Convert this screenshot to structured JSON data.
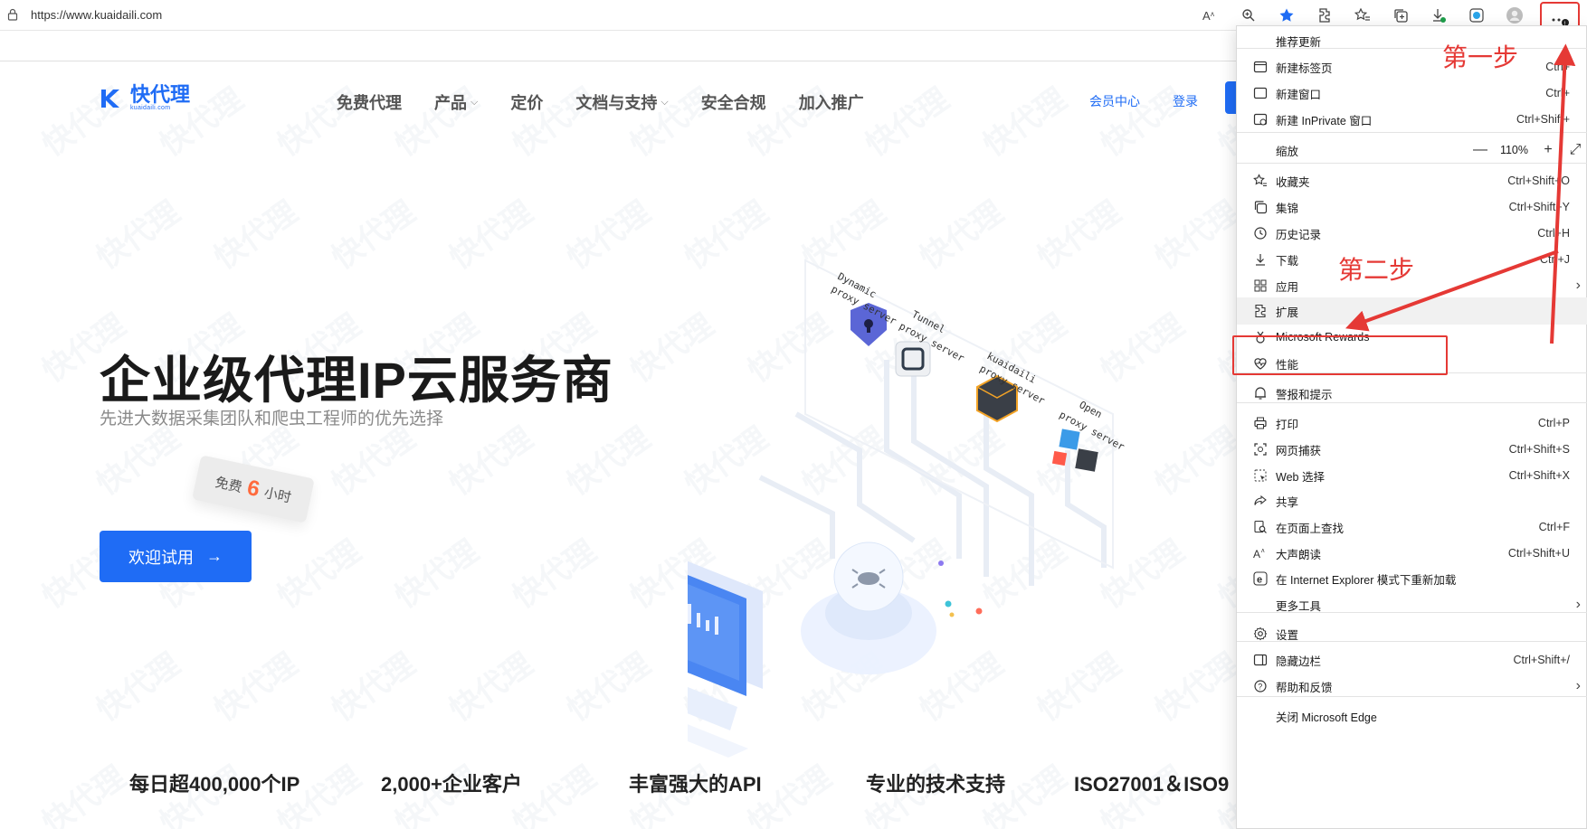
{
  "browser": {
    "url": "https://www.kuaidaili.com",
    "toolbar_icons": [
      "read-aloud-icon",
      "zoom-icon",
      "favorite-star-icon",
      "extensions-icon",
      "favorites-icon",
      "collections-icon",
      "downloads-icon",
      "edge-icon",
      "profile-icon",
      "more-icon"
    ]
  },
  "site": {
    "logo_text": "快代理",
    "logo_sub": "kuaidaili.com",
    "nav": [
      {
        "label": "免费代理",
        "has_caret": false
      },
      {
        "label": "产品",
        "has_caret": true
      },
      {
        "label": "定价",
        "has_caret": false
      },
      {
        "label": "文档与支持",
        "has_caret": true
      },
      {
        "label": "安全合规",
        "has_caret": false
      },
      {
        "label": "加入推广",
        "has_caret": false
      }
    ],
    "member_center": "会员中心",
    "login": "登录",
    "watermark_text": "快代理",
    "hero_title": "企业级代理IP云服务商",
    "hero_subtitle": "先进大数据采集团队和爬虫工程师的优先选择",
    "free_tag": {
      "prefix": "免费",
      "num": "6",
      "suffix": "小时"
    },
    "cta_label": "欢迎试用",
    "cta_arrow": "→",
    "illustration_labels": {
      "dynamic": [
        "Dynamic",
        "proxy server"
      ],
      "tunnel": [
        "Tunnel",
        "proxy server"
      ],
      "kuaidaili": [
        "kuaidaili",
        "proxy server"
      ],
      "open": [
        "Open",
        "proxy server"
      ]
    },
    "stats": [
      "每日超400,000个IP",
      "2,000+企业客户",
      "丰富强大的API",
      "专业的技术支持",
      "ISO27001＆ISO9"
    ]
  },
  "menu": {
    "items": [
      {
        "icon": "none",
        "label": "推荐更新",
        "shortcut": ""
      },
      {
        "icon": "new-tab-icon",
        "label": "新建标签页",
        "shortcut": "Ctrl+"
      },
      {
        "icon": "new-window-icon",
        "label": "新建窗口",
        "shortcut": "Ctrl+"
      },
      {
        "icon": "inprivate-icon",
        "label": "新建 InPrivate 窗口",
        "shortcut": "Ctrl+Shift+"
      },
      {
        "icon": "none",
        "label": "缩放",
        "zoom_value": "110%",
        "zoom_minus": "—",
        "zoom_plus": "+",
        "zoom_full": "⤢"
      },
      {
        "icon": "favorites-icon",
        "label": "收藏夹",
        "shortcut": "Ctrl+Shift+O"
      },
      {
        "icon": "collections-icon",
        "label": "集锦",
        "shortcut": "Ctrl+Shift+Y"
      },
      {
        "icon": "history-icon",
        "label": "历史记录",
        "shortcut": "Ctrl+H"
      },
      {
        "icon": "download-icon",
        "label": "下载",
        "shortcut": "Ctrl+J"
      },
      {
        "icon": "apps-icon",
        "label": "应用",
        "shortcut": "",
        "chevron": "›"
      },
      {
        "icon": "extensions-icon",
        "label": "扩展",
        "shortcut": ""
      },
      {
        "icon": "rewards-icon",
        "label": "Microsoft Rewards",
        "shortcut": ""
      },
      {
        "icon": "performance-icon",
        "label": "性能",
        "shortcut": ""
      },
      {
        "icon": "alert-icon",
        "label": "警报和提示",
        "shortcut": ""
      },
      {
        "icon": "print-icon",
        "label": "打印",
        "shortcut": "Ctrl+P"
      },
      {
        "icon": "screenshot-icon",
        "label": "网页捕获",
        "shortcut": "Ctrl+Shift+S"
      },
      {
        "icon": "web-select-icon",
        "label": "Web 选择",
        "shortcut": "Ctrl+Shift+X"
      },
      {
        "icon": "share-icon",
        "label": "共享",
        "shortcut": ""
      },
      {
        "icon": "find-icon",
        "label": "在页面上查找",
        "shortcut": "Ctrl+F"
      },
      {
        "icon": "read-aloud-icon",
        "label": "大声朗读",
        "shortcut": "Ctrl+Shift+U"
      },
      {
        "icon": "ie-icon",
        "label": "在 Internet Explorer 模式下重新加载",
        "shortcut": ""
      },
      {
        "icon": "none",
        "label": "更多工具",
        "shortcut": "",
        "chevron": "›"
      },
      {
        "icon": "settings-icon",
        "label": "设置",
        "shortcut": ""
      },
      {
        "icon": "sidebar-icon",
        "label": "隐藏边栏",
        "shortcut": "Ctrl+Shift+/"
      },
      {
        "icon": "help-icon",
        "label": "帮助和反馈",
        "shortcut": "",
        "chevron": "›"
      },
      {
        "icon": "none",
        "label": "关闭 Microsoft Edge",
        "shortcut": ""
      }
    ]
  },
  "annotations": {
    "step1": "第一步",
    "step2": "第二步",
    "color": "#e53935"
  },
  "colors": {
    "brand": "#1f6cf5",
    "annotation": "#e53935",
    "free_number": "#ff6a3d"
  }
}
